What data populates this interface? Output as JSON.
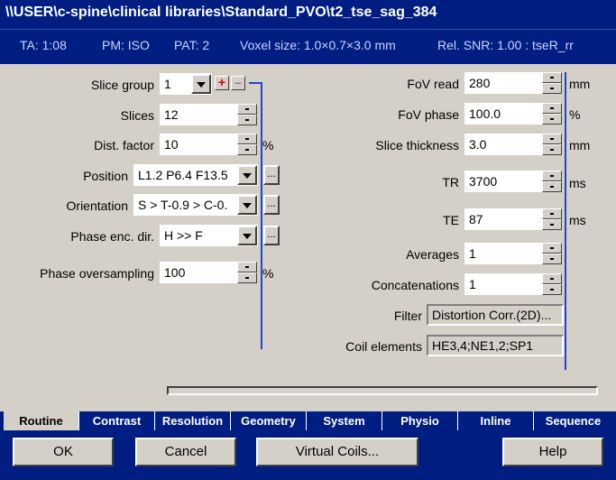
{
  "window": {
    "title": "\\\\USER\\c-spine\\clinical libraries\\Standard_PVO\\t2_tse_sag_384"
  },
  "info": {
    "ta": "TA: 1:08",
    "pm": "PM: ISO",
    "pat": "PAT: 2",
    "voxel": "Voxel size: 1.0×0.7×3.0 mm",
    "snr": "Rel. SNR: 1.00 : tseR_rr"
  },
  "left": {
    "slice_group": {
      "label": "Slice group",
      "value": "1",
      "add": "+",
      "remove": "–"
    },
    "slices": {
      "label": "Slices",
      "value": "12"
    },
    "dist_factor": {
      "label": "Dist. factor",
      "value": "10",
      "unit": "%"
    },
    "position": {
      "label": "Position",
      "value": "L1.2 P6.4 F13.5",
      "more": "..."
    },
    "orientation": {
      "label": "Orientation",
      "value": "S > T-0.9 > C-0.",
      "more": "..."
    },
    "phase_enc": {
      "label": "Phase enc. dir.",
      "value": "H >> F",
      "more": "..."
    },
    "phase_os": {
      "label": "Phase oversampling",
      "value": "100",
      "unit": "%"
    }
  },
  "right": {
    "fov_read": {
      "label": "FoV read",
      "value": "280",
      "unit": "mm"
    },
    "fov_phase": {
      "label": "FoV phase",
      "value": "100.0",
      "unit": "%"
    },
    "slice_thickness": {
      "label": "Slice thickness",
      "value": "3.0",
      "unit": "mm"
    },
    "tr": {
      "label": "TR",
      "value": "3700",
      "unit": "ms"
    },
    "te": {
      "label": "TE",
      "value": "87",
      "unit": "ms"
    },
    "averages": {
      "label": "Averages",
      "value": "1"
    },
    "concatenations": {
      "label": "Concatenations",
      "value": "1"
    },
    "filter": {
      "label": "Filter",
      "value": "Distortion Corr.(2D)..."
    },
    "coil": {
      "label": "Coil elements",
      "value": "HE3,4;NE1,2;SP1"
    }
  },
  "tabs": [
    "Routine",
    "Contrast",
    "Resolution",
    "Geometry",
    "System",
    "Physio",
    "Inline",
    "Sequence"
  ],
  "active_tab": "Routine",
  "buttons": {
    "ok": "OK",
    "cancel": "Cancel",
    "virtual_coils": "Virtual Coils...",
    "help": "Help"
  },
  "colors": {
    "title_bg": "#001e82",
    "panel_bg": "#d4d0c8",
    "accent_line": "#1e46d2"
  }
}
